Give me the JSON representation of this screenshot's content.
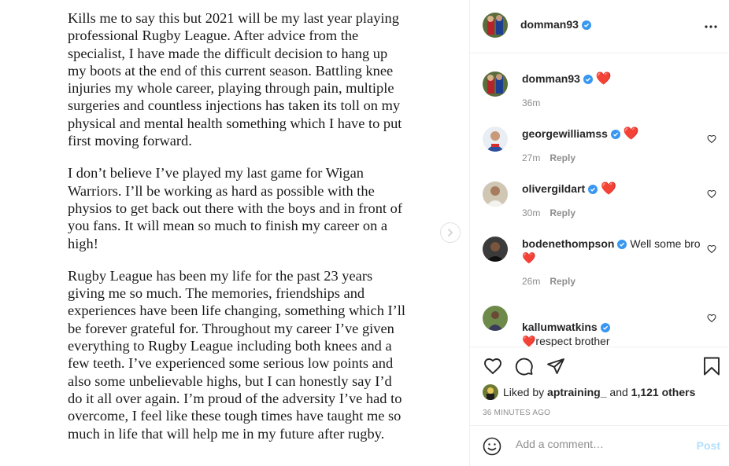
{
  "post": {
    "paragraphs": [
      "Kills me to say this but 2021 will be my last year playing professional Rugby League. After advice from the specialist, I have made the difficult decision to hang up my boots at the end of this current season. Battling knee injuries my whole career, playing through pain, multiple surgeries and countless injections has taken its toll on my physical and mental health something which I have to put first moving forward.",
      "I don’t believe I’ve played my last game for Wigan Warriors. I’ll be working as hard as possible with the physios to get back out there with the boys and in front of you fans. It will mean so much to finish my career on a high!",
      "Rugby League has been my life for the past 23 years giving me so much. The memories, friendships and experiences have been life changing, something which I’ll be forever grateful for. Throughout my career I’ve given everything to Rugby League including both knees and a few teeth. I’ve experienced some serious low points and also some unbelievable highs, but I can honestly say I’d do it all over again. I’m proud of the adversity I’ve had to overcome, I feel like these tough times have taught me so much in life that will help me in my future after rugby."
    ]
  },
  "header": {
    "username": "domman93",
    "more_icon": "more-horizontal-icon"
  },
  "comments": [
    {
      "username": "domman93",
      "text": "❤️",
      "time": "36m",
      "reply": ""
    },
    {
      "username": "georgewilliamss",
      "text": "❤️",
      "time": "27m",
      "reply": "Reply"
    },
    {
      "username": "olivergildart",
      "text": "❤️",
      "time": "30m",
      "reply": "Reply"
    },
    {
      "username": "bodenethompson",
      "text": "Well some bro ❤️",
      "time": "26m",
      "reply": "Reply"
    },
    {
      "username": "kallumwatkins",
      "text": "❤️respect brother\nWish you all the best 👊🏾",
      "time": "",
      "reply": ""
    }
  ],
  "likes": {
    "prefix": "Liked by",
    "user": "aptraining_",
    "and": "and",
    "others": "1,121 others"
  },
  "time_ago": "36 MINUTES AGO",
  "add_comment": {
    "placeholder": "Add a comment…",
    "post_label": "Post"
  },
  "colors": {
    "verified": "#3897f0",
    "heart": "#ed4956",
    "post_disabled": "#b2dffc"
  }
}
